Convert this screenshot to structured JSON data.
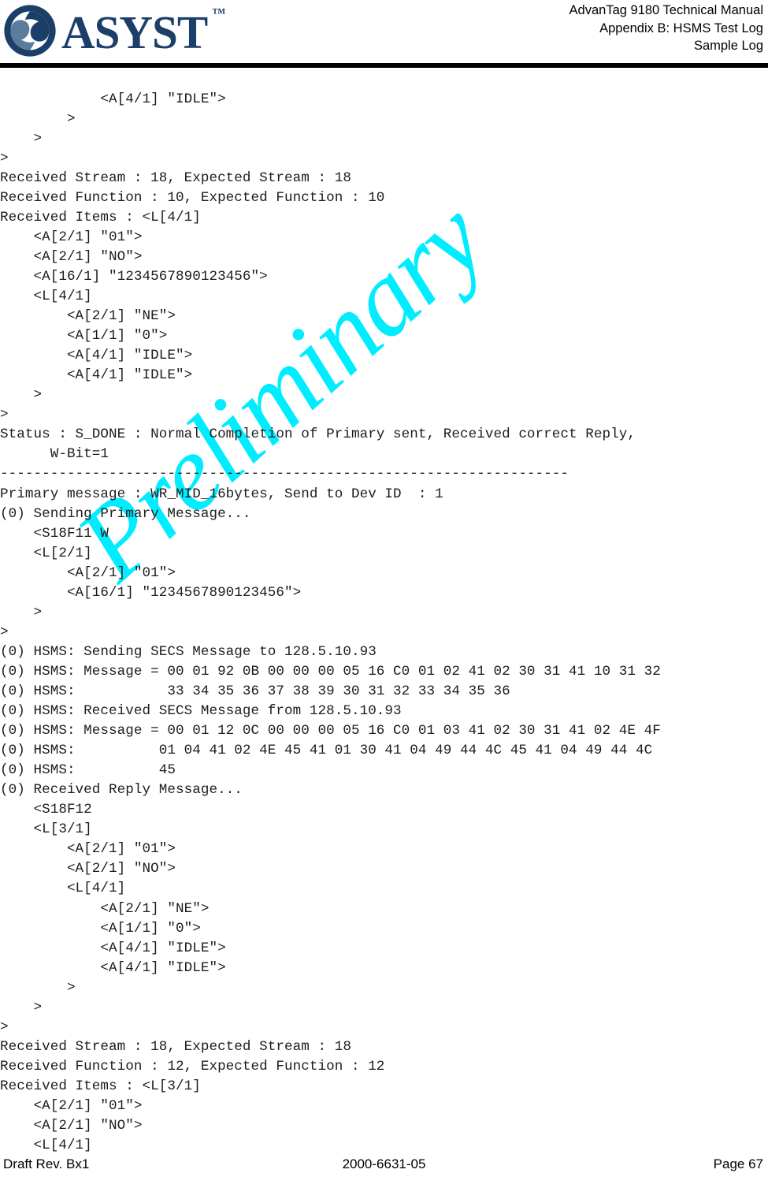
{
  "document": {
    "header": {
      "logo_word": "ASYST",
      "logo_tm": "™",
      "logo_mark_icon": "asyst-swirl-logo-icon",
      "title_line1": "AdvanTag 9180 Technical Manual",
      "title_line2": "Appendix B: HSMS Test Log",
      "title_line3": "Sample Log"
    },
    "watermark": {
      "text": "Preliminary",
      "color": "#00ecff"
    },
    "footer": {
      "left": "Draft Rev. Bx1",
      "center": "2000-6631-05",
      "right": "Page 67"
    },
    "brand_colors": {
      "logo_navy": "#1b3f69",
      "logo_steel": "#5c7c9b",
      "rule_black": "#000000",
      "body_text": "#1c1c1c"
    },
    "log_lines": [
      "            <A[4/1] \"IDLE\">",
      "        >",
      "    >",
      ">",
      "Received Stream : 18, Expected Stream : 18",
      "Received Function : 10, Expected Function : 10",
      "Received Items : <L[4/1]",
      "    <A[2/1] \"01\">",
      "    <A[2/1] \"NO\">",
      "    <A[16/1] \"1234567890123456\">",
      "    <L[4/1]",
      "        <A[2/1] \"NE\">",
      "        <A[1/1] \"0\">",
      "        <A[4/1] \"IDLE\">",
      "        <A[4/1] \"IDLE\">",
      "    >",
      ">",
      "Status : S_DONE : Normal Completion of Primary sent, Received correct Reply,",
      "      W-Bit=1",
      "--------------------------------------------------------------------",
      "Primary message : WR_MID_16bytes, Send to Dev ID  : 1",
      "(0) Sending Primary Message...",
      "    <S18F11 W",
      "    <L[2/1]",
      "        <A[2/1] \"01\">",
      "        <A[16/1] \"1234567890123456\">",
      "    >",
      ">",
      "(0) HSMS: Sending SECS Message to 128.5.10.93",
      "(0) HSMS: Message = 00 01 92 0B 00 00 00 05 16 C0 01 02 41 02 30 31 41 10 31 32",
      "(0) HSMS:           33 34 35 36 37 38 39 30 31 32 33 34 35 36",
      "(0) HSMS: Received SECS Message from 128.5.10.93",
      "(0) HSMS: Message = 00 01 12 0C 00 00 00 05 16 C0 01 03 41 02 30 31 41 02 4E 4F",
      "(0) HSMS:          01 04 41 02 4E 45 41 01 30 41 04 49 44 4C 45 41 04 49 44 4C",
      "(0) HSMS:          45",
      "(0) Received Reply Message...",
      "    <S18F12",
      "    <L[3/1]",
      "        <A[2/1] \"01\">",
      "        <A[2/1] \"NO\">",
      "        <L[4/1]",
      "            <A[2/1] \"NE\">",
      "            <A[1/1] \"0\">",
      "            <A[4/1] \"IDLE\">",
      "            <A[4/1] \"IDLE\">",
      "        >",
      "    >",
      ">",
      "Received Stream : 18, Expected Stream : 18",
      "Received Function : 12, Expected Function : 12",
      "Received Items : <L[3/1]",
      "    <A[2/1] \"01\">",
      "    <A[2/1] \"NO\">",
      "    <L[4/1]"
    ]
  }
}
